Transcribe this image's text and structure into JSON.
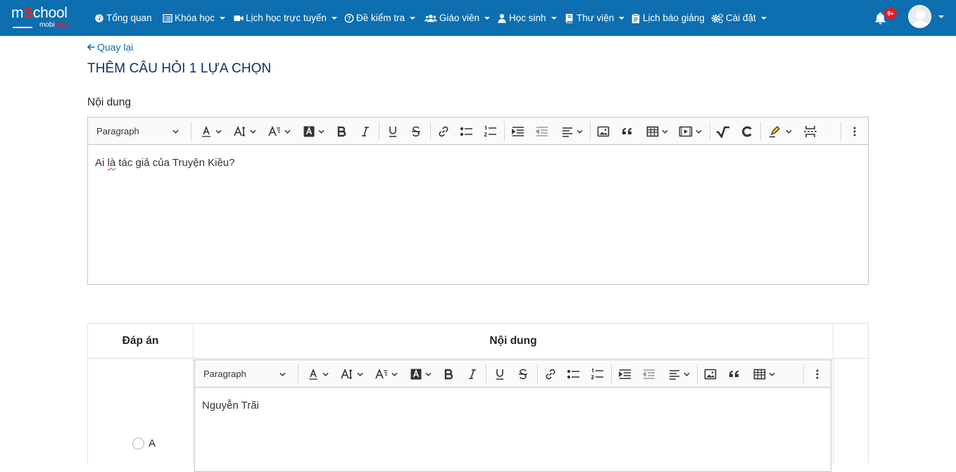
{
  "brand": {
    "main_prefix": "m",
    "main_o": "S",
    "main_suffix": "chool",
    "sub_prefix": "mobi",
    "sub_suffix": "Edu"
  },
  "nav": {
    "items": [
      {
        "label": "Tổng quan",
        "icon": "dashboard-icon",
        "dropdown": false
      },
      {
        "label": "Khóa học",
        "icon": "list-icon",
        "dropdown": true
      },
      {
        "label": "Lịch học trực tuyến",
        "icon": "video-icon",
        "dropdown": true
      },
      {
        "label": "Đề kiểm tra",
        "icon": "question-circle-icon",
        "dropdown": true
      },
      {
        "label": "Giáo viên",
        "icon": "users-icon",
        "dropdown": true
      },
      {
        "label": "Học sinh",
        "icon": "user-icon",
        "dropdown": true
      },
      {
        "label": "Thư viện",
        "icon": "book-icon",
        "dropdown": true
      },
      {
        "label": "Lịch báo giảng",
        "icon": "clipboard-icon",
        "dropdown": false
      },
      {
        "label": "Cài đặt",
        "icon": "cogs-icon",
        "dropdown": true
      }
    ],
    "notification_badge": "9+"
  },
  "page": {
    "back_label": "Quay lại",
    "title": "THÊM CÂU HỎI 1 LỰA CHỌN",
    "content_label": "Nội dung"
  },
  "question_editor": {
    "heading_select": "Paragraph",
    "content_part1": "Ai ",
    "content_misspelled": "là",
    "content_part2": " tác giả của Truyện Kiều?"
  },
  "answers": {
    "columns": [
      "Đáp án",
      "Nội dung"
    ],
    "rows": [
      {
        "option": "A",
        "heading_select": "Paragraph",
        "content": "Nguyễn Trãi"
      }
    ]
  },
  "colors": {
    "navbar": "#0d6eb0",
    "title": "#0e3064",
    "link": "#0d6eb0",
    "badge": "#dc1e2a"
  }
}
